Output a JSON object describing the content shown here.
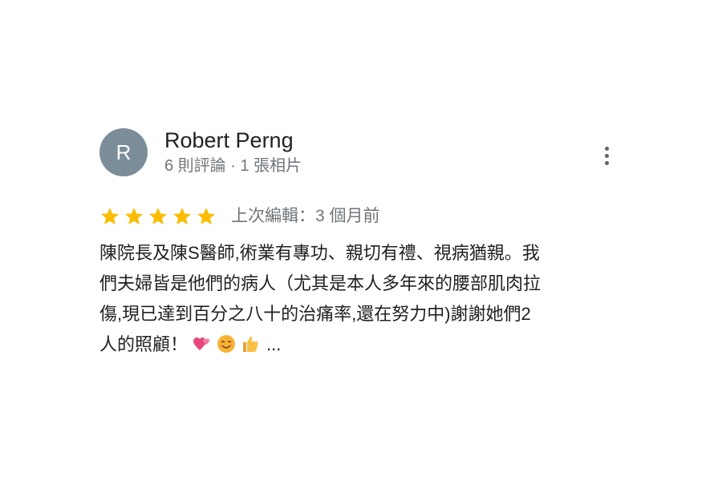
{
  "review": {
    "author": {
      "avatar_letter": "R",
      "avatar_color": "#7b8d98",
      "name": "Robert Perng",
      "meta": "6 則評論 · 1 張相片"
    },
    "menu_icon": "more-vert-icon",
    "rating": {
      "stars": 5,
      "max_stars": 5,
      "star_color": "#fbbc04",
      "edited_label": "上次編輯：3 個月前"
    },
    "text_lines": [
      "陳院長及陳S醫師,術業有專功、親切有禮、視病猶親。我",
      "們夫婦皆是他們的病人（尤其是本人多年來的腰部肌肉拉",
      "傷,現已達到百分之八十的治痛率,還在努力中)謝謝她們2",
      "人的照顧！"
    ],
    "emojis": [
      "two-hearts-icon",
      "smiling-face-icon",
      "thumbs-up-icon"
    ],
    "more_label": "..."
  }
}
